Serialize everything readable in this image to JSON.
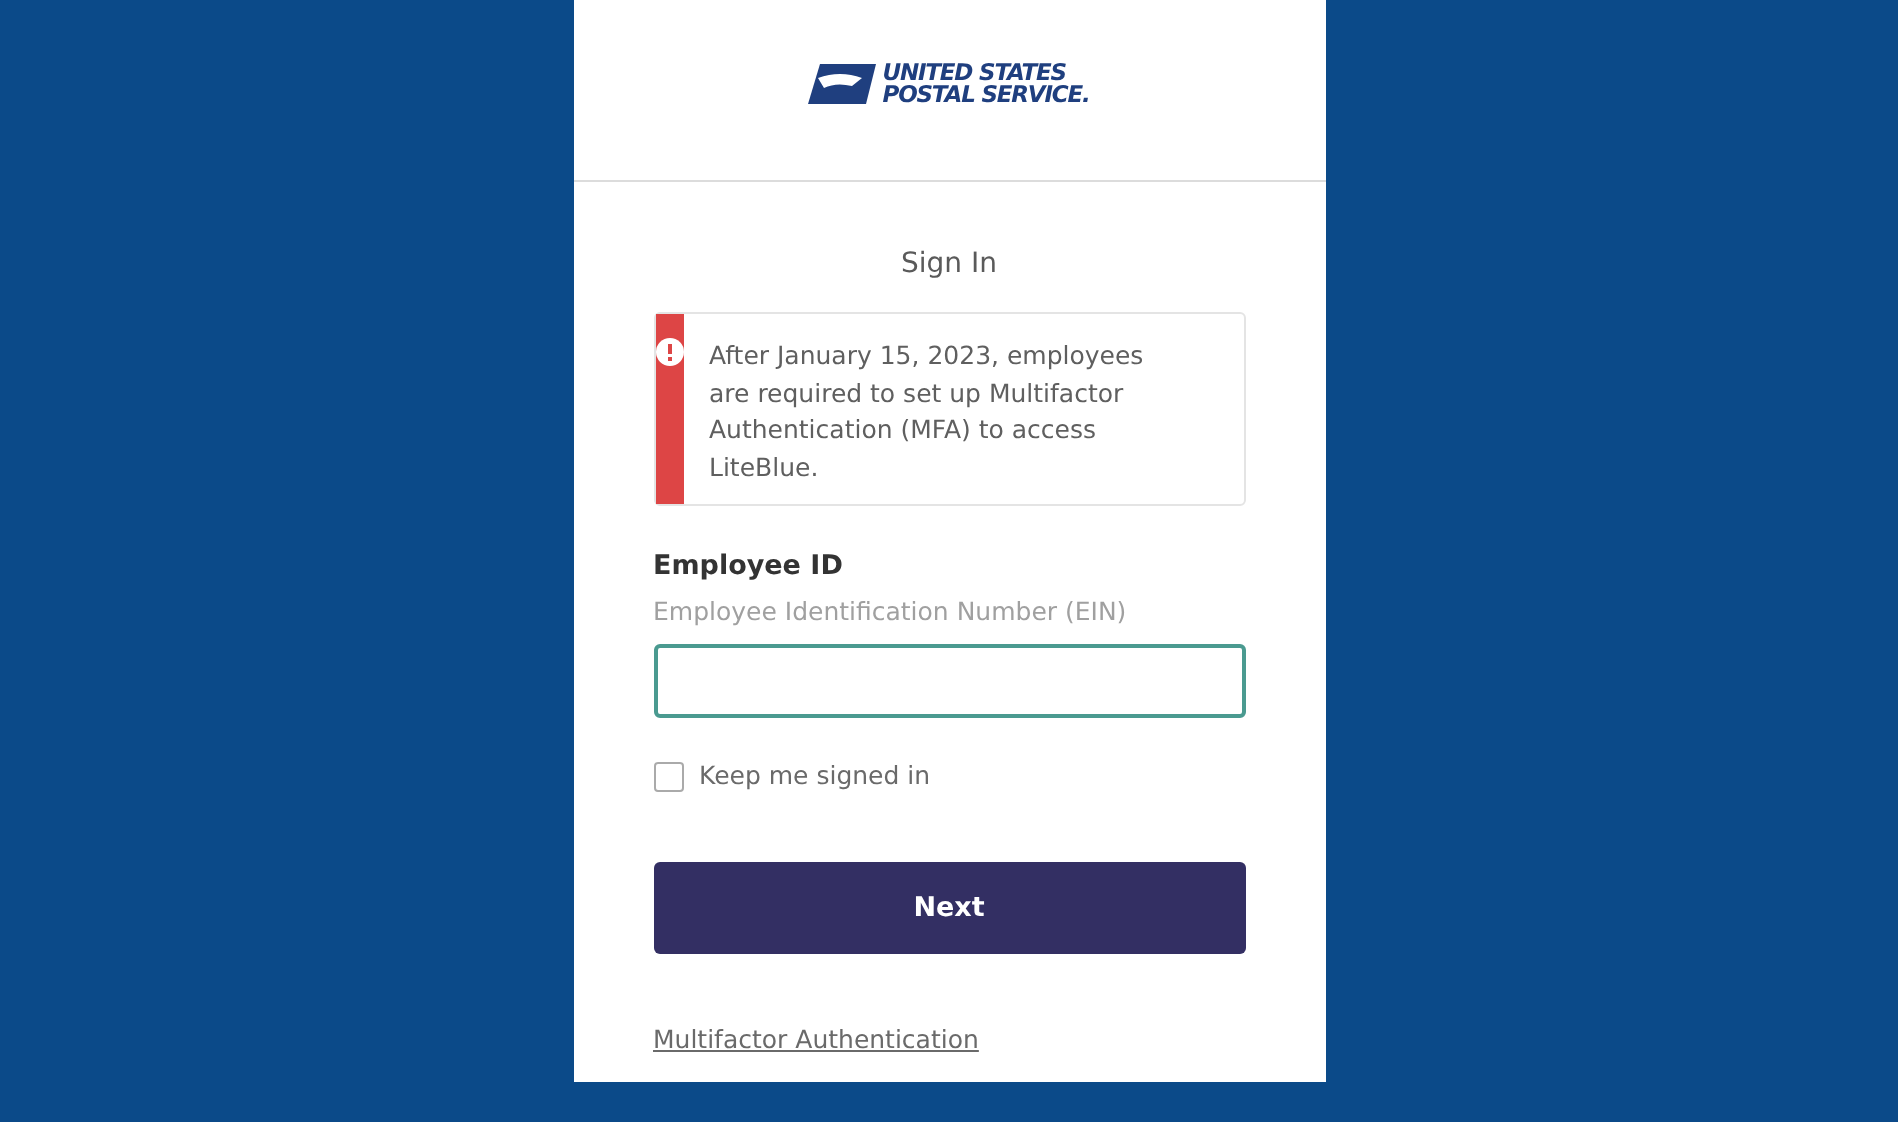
{
  "logo": {
    "lines": [
      "UNITED STATES",
      "POSTAL SERVICE."
    ]
  },
  "title": "Sign In",
  "alert": {
    "kind": "error",
    "message": "After January 15, 2023, employees are required to set up Multifactor Authentication (MFA) to access LiteBlue."
  },
  "employee_id": {
    "label": "Employee ID",
    "hint": "Employee Identification Number (EIN)",
    "focused": true
  },
  "keep_signed_in": {
    "label": "Keep me signed in",
    "checked": false
  },
  "next_button": {
    "label": "Next"
  },
  "mfa_link": {
    "label": "Multifactor Authentication"
  }
}
